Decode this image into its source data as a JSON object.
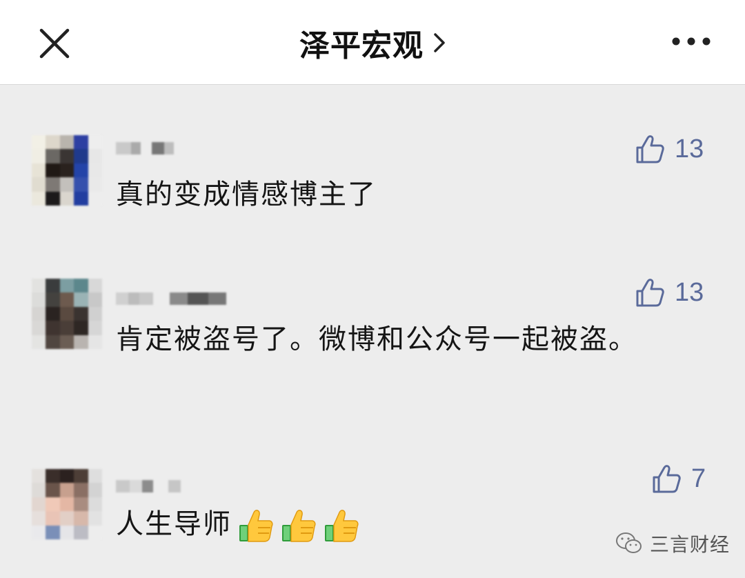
{
  "header": {
    "title": "泽平宏观",
    "close_icon": "close-icon",
    "more_icon": "more-icon",
    "chevron_icon": "chevron-right-icon"
  },
  "comments": [
    {
      "text": "真的变成情感博主了",
      "likes": "13"
    },
    {
      "text": "肯定被盗号了。微博和公众号一起被盗。",
      "likes": "13"
    },
    {
      "text": "人生导师",
      "likes": "7",
      "emoji": [
        "thumbs-up-icon",
        "thumbs-up-icon",
        "thumbs-up-icon"
      ]
    }
  ],
  "watermark": {
    "text": "三言财经",
    "icon": "wechat-icon"
  },
  "colors": {
    "like_blue": "#5a6a9a",
    "background": "#ededed"
  }
}
